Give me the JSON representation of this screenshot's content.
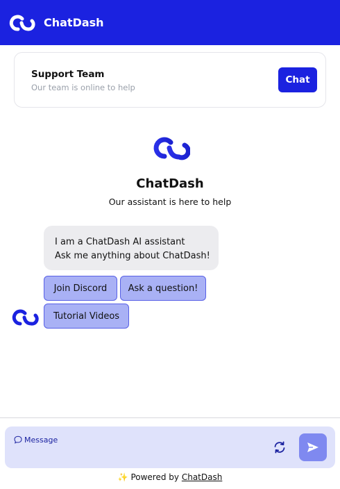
{
  "header": {
    "app_title": "ChatDash"
  },
  "support": {
    "team_name": "Support Team",
    "status": "Our team is online to help",
    "chat_label": "Chat"
  },
  "hero": {
    "title": "ChatDash",
    "subtitle": "Our assistant is here to help"
  },
  "bot_message": {
    "lines": [
      "I am a ChatDash AI assistant",
      "Ask me anything about ChatDash!"
    ]
  },
  "quick_replies": [
    "Join Discord",
    "Ask a question!",
    "Tutorial Videos"
  ],
  "composer": {
    "placeholder": "Message"
  },
  "footer": {
    "sparkle": "✨",
    "powered_prefix": "Powered by",
    "brand": "ChatDash"
  },
  "colors": {
    "brand": "#1b22e0",
    "quick_reply_bg": "#a9b1f5",
    "input_bg": "#dfe2fb",
    "send_bg": "#7f89f0"
  },
  "icons": [
    "chatdash-logo-icon",
    "message-bubble-icon",
    "refresh-icon",
    "send-icon"
  ]
}
